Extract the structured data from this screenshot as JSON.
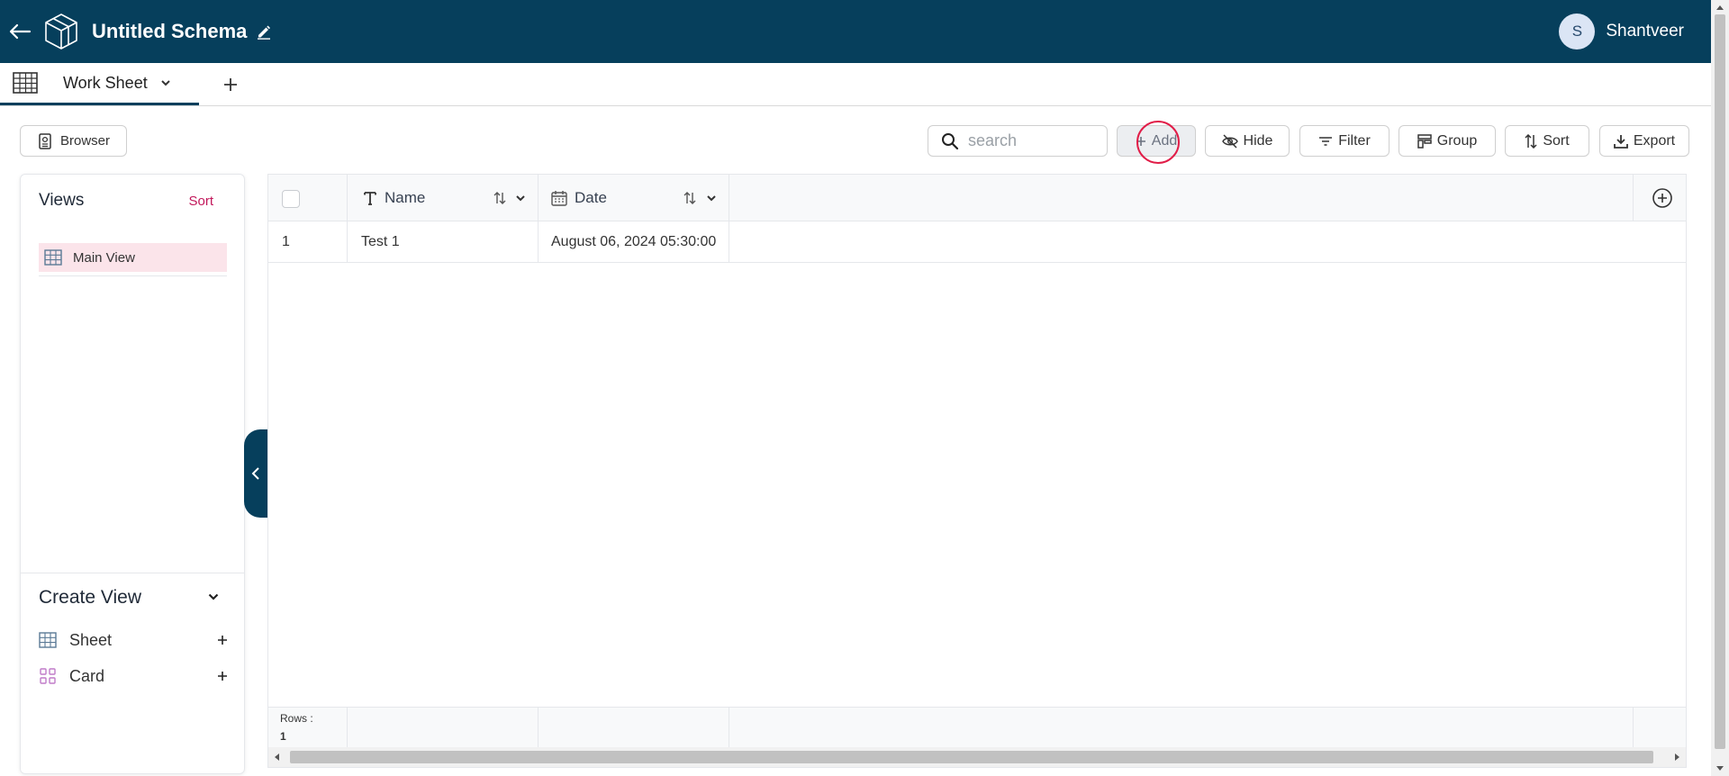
{
  "header": {
    "title": "Untitled Schema",
    "user_initial": "S",
    "user_name": "Shantveer"
  },
  "tabs": [
    {
      "label": "Work Sheet"
    }
  ],
  "toolbar": {
    "browser_label": "Browser",
    "search_placeholder": "search",
    "add_label": "Add",
    "hide_label": "Hide",
    "filter_label": "Filter",
    "group_label": "Group",
    "sort_label": "Sort",
    "export_label": "Export"
  },
  "sidebar": {
    "views_title": "Views",
    "views_sort": "Sort",
    "views": [
      {
        "label": "Main View"
      }
    ],
    "create_title": "Create View",
    "create_items": [
      {
        "label": "Sheet"
      },
      {
        "label": "Card"
      }
    ]
  },
  "grid": {
    "columns": [
      {
        "label": "Name"
      },
      {
        "label": "Date"
      }
    ],
    "rows": [
      {
        "index": "1",
        "name": "Test 1",
        "date": "August 06, 2024 05:30:00"
      }
    ],
    "rows_label": "Rows :",
    "rows_count": "1"
  },
  "colors": {
    "header_bg": "#063f5c",
    "accent": "#c2185b",
    "selected_view_bg": "#fbe4ea"
  }
}
